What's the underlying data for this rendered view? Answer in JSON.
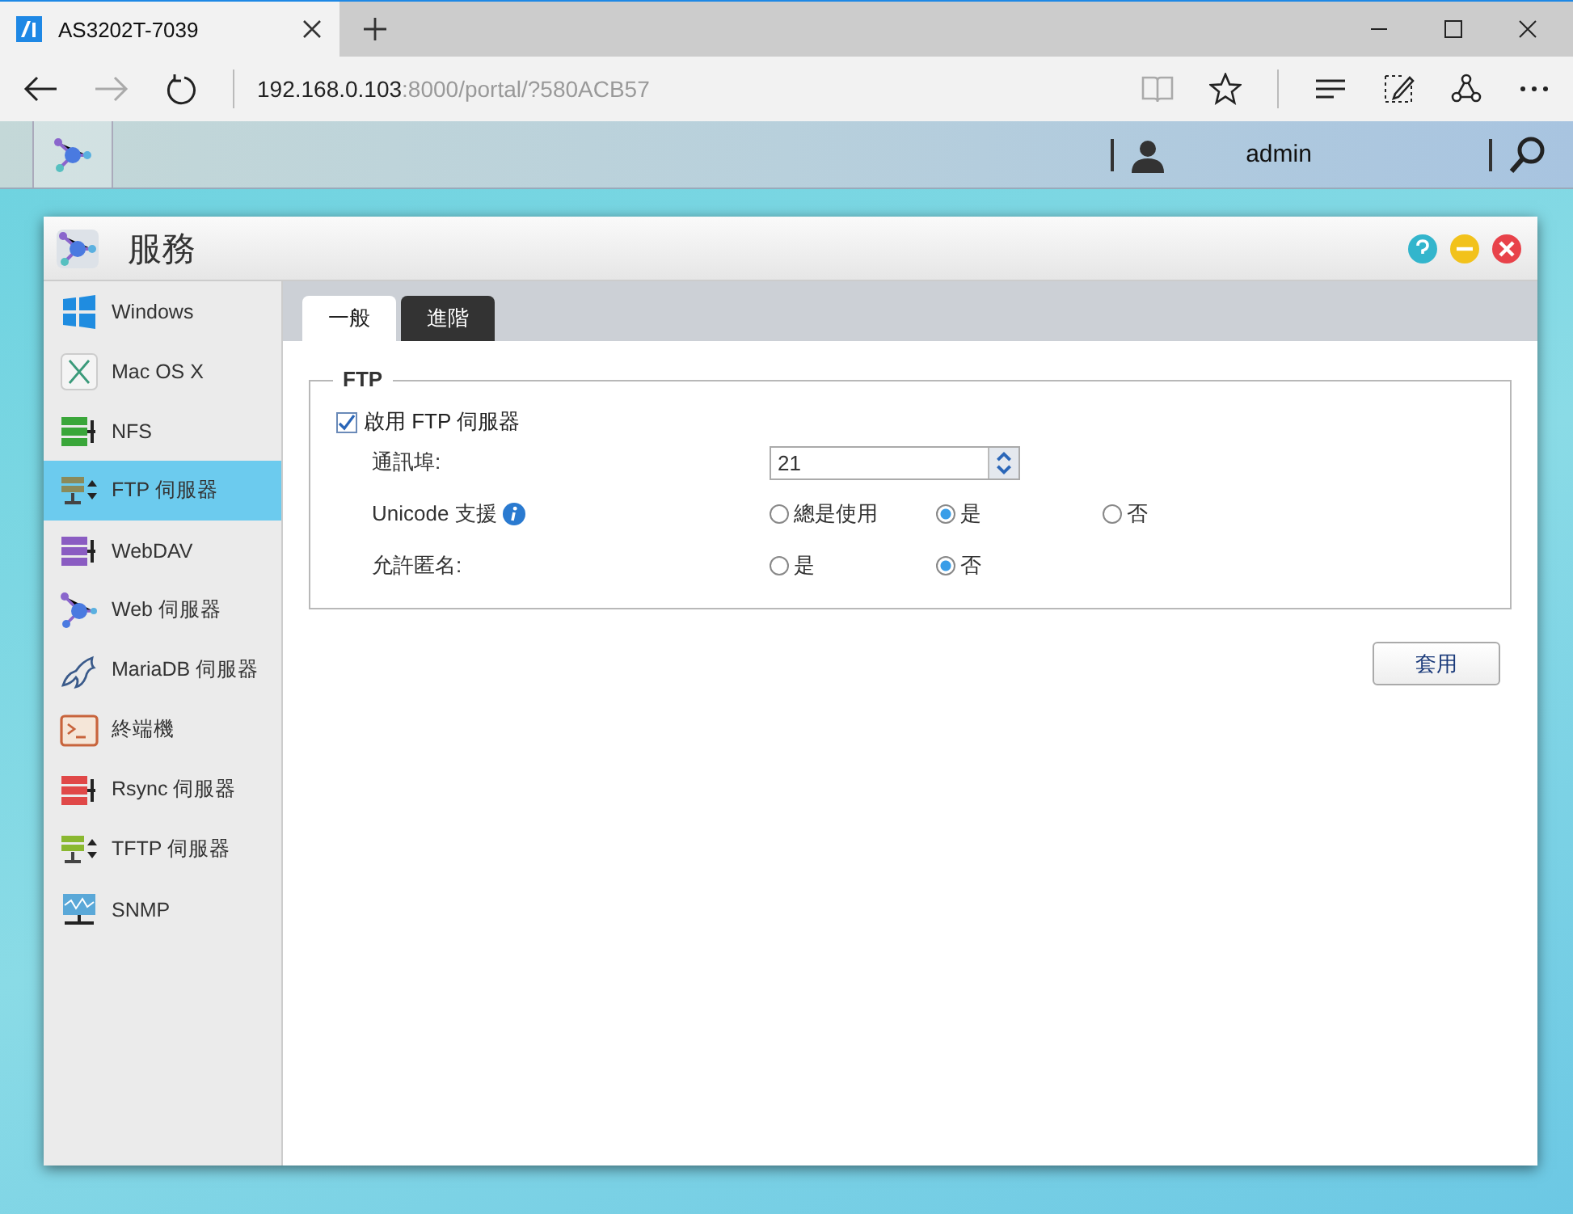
{
  "browser": {
    "tab_title": "AS3202T-7039",
    "address_host": "192.168.0.103",
    "address_rest": ":8000/portal/?580ACB57"
  },
  "toolbar": {
    "user": "admin"
  },
  "window": {
    "title": "服務"
  },
  "sidebar": {
    "items": [
      {
        "label": "Windows",
        "kind": "windows",
        "selected": false
      },
      {
        "label": "Mac OS X",
        "kind": "mac",
        "selected": false
      },
      {
        "label": "NFS",
        "kind": "nfs",
        "selected": false
      },
      {
        "label": "FTP 伺服器",
        "kind": "ftp",
        "selected": true
      },
      {
        "label": "WebDAV",
        "kind": "webdav",
        "selected": false
      },
      {
        "label": "Web 伺服器",
        "kind": "web",
        "selected": false
      },
      {
        "label": "MariaDB 伺服器",
        "kind": "mariadb",
        "selected": false
      },
      {
        "label": "終端機",
        "kind": "terminal",
        "selected": false
      },
      {
        "label": "Rsync 伺服器",
        "kind": "rsync",
        "selected": false
      },
      {
        "label": "TFTP 伺服器",
        "kind": "tftp",
        "selected": false
      },
      {
        "label": "SNMP",
        "kind": "snmp",
        "selected": false
      }
    ]
  },
  "tabs": [
    {
      "label": "一般",
      "selected": true
    },
    {
      "label": "進階",
      "selected": false
    }
  ],
  "ftp": {
    "legend": "FTP",
    "enable": {
      "label": "啟用 FTP 伺服器",
      "checked": true
    },
    "port": {
      "label": "通訊埠:",
      "value": "21"
    },
    "unicode": {
      "label": "Unicode 支援",
      "options": [
        {
          "label": "總是使用",
          "selected": false
        },
        {
          "label": "是",
          "selected": true
        },
        {
          "label": "否",
          "selected": false
        }
      ]
    },
    "anonymous": {
      "label": "允許匿名:",
      "options": [
        {
          "label": "是",
          "selected": false
        },
        {
          "label": "否",
          "selected": true
        }
      ]
    }
  },
  "apply_button": "套用"
}
